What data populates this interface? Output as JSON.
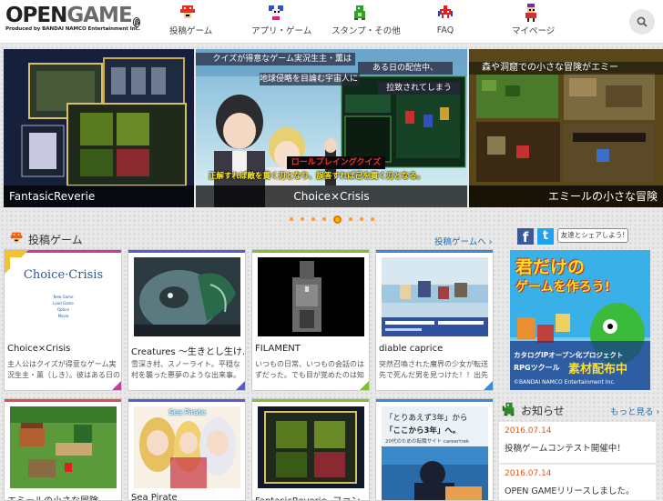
{
  "header": {
    "logo_main": "OPEN",
    "logo_game": "GAME",
    "logo_mark": "β",
    "logo_sub": "Produced by BANDAI NAMCO Entertainment Inc.",
    "nav": [
      {
        "label": "投稿ゲーム",
        "icon": "pixel-mushroom-icon"
      },
      {
        "label": "アプリ・ゲーム",
        "icon": "pixel-mouse-icon"
      },
      {
        "label": "スタンプ・その他",
        "icon": "pixel-dragon-icon"
      },
      {
        "label": "FAQ",
        "icon": "pixel-invader-icon"
      },
      {
        "label": "マイページ",
        "icon": "pixel-character-icon"
      }
    ],
    "search_icon": "search-icon"
  },
  "carousel": {
    "slides": [
      {
        "caption": "FantasicReverie"
      },
      {
        "caption": "Choice×Crisis",
        "banner1": "クイズが得意なゲーム実況生主・薫は",
        "banner2": "地球侵略を目論む宇宙人に",
        "banner3": "ある日の配信中、",
        "banner4": "拉致されてしまう",
        "genre": "ロールプレイングクイズ",
        "tagline": "正解すれば敵を貫く刃となり、誤答すれば己を貫く刃となる。"
      },
      {
        "caption": "エミールの小さな冒険",
        "banner1": "森や洞窟での小さな冒険がエミー"
      }
    ],
    "dot_count": 8,
    "active_dot": 4
  },
  "posted": {
    "title": "投稿ゲーム",
    "more": "投稿ゲームへ ›",
    "cards": [
      {
        "title": "Choice×Crisis",
        "desc": "主人公はクイズが得意なゲーム実況生主・薫（しき）。彼はある日の",
        "color": "#c040a0",
        "thumb_title": "Choice",
        "thumb_title2": "Crisis",
        "menu": [
          "New Game",
          "Load Game",
          "Option",
          "Movie"
        ]
      },
      {
        "title": "Creatures ～生きとし生け…",
        "desc": "雪深き村、スノーライト。平穏な村を襲った悪夢のような出来事。伝説",
        "color": "#5c5cc8"
      },
      {
        "title": "FILAMENT",
        "desc": "いつもの日常、いつもの会話のはずだった。でも目が覚めたのは知らな",
        "color": "#80c030"
      },
      {
        "title": "diable caprice",
        "desc": "突然召喚された魔界の少女が転送先で死んだ男を見つけた！！出先で死",
        "color": "#3a8ad8"
      },
      {
        "title": "エミールの小さな冒険",
        "desc": "",
        "color": "#e05050"
      },
      {
        "title": "Sea Pirate",
        "desc": "",
        "color": "#5c5cc8",
        "thumb_title": "Sea Pirate"
      },
      {
        "title": "FantasicReverie -ファン…",
        "desc": "",
        "color": "#80c030"
      },
      {
        "title": "",
        "desc": "",
        "color": "#3a8ad8",
        "ad1": "「とりあえず3年」から",
        "ad2": "「ここから3年」へ。",
        "ad3": "20代のための転職サイト careertrek"
      }
    ]
  },
  "social": {
    "fb": "f",
    "tw": "t",
    "share": "友達とシェアしよう!"
  },
  "sidebar_ad": {
    "line1": "君だけの",
    "line2": "ゲームを作ろう!",
    "line3": "カタログIPオープン化プロジェクト",
    "line4": "RPGツクール",
    "line5": "素材配布中",
    "line6": "©BANDAI NAMCO Entertainment Inc."
  },
  "news": {
    "title": "お知らせ",
    "more": "もっと見る ›",
    "items": [
      {
        "date": "2016.07.14",
        "text": "投稿ゲームコンテスト開催中！"
      },
      {
        "date": "2016.07.14",
        "text": "OPEN GAMEリリースしました。"
      }
    ]
  },
  "colors": {
    "accent": "#1e6fb8",
    "date": "#e05a1a",
    "section_icon": "#ff5a00"
  }
}
